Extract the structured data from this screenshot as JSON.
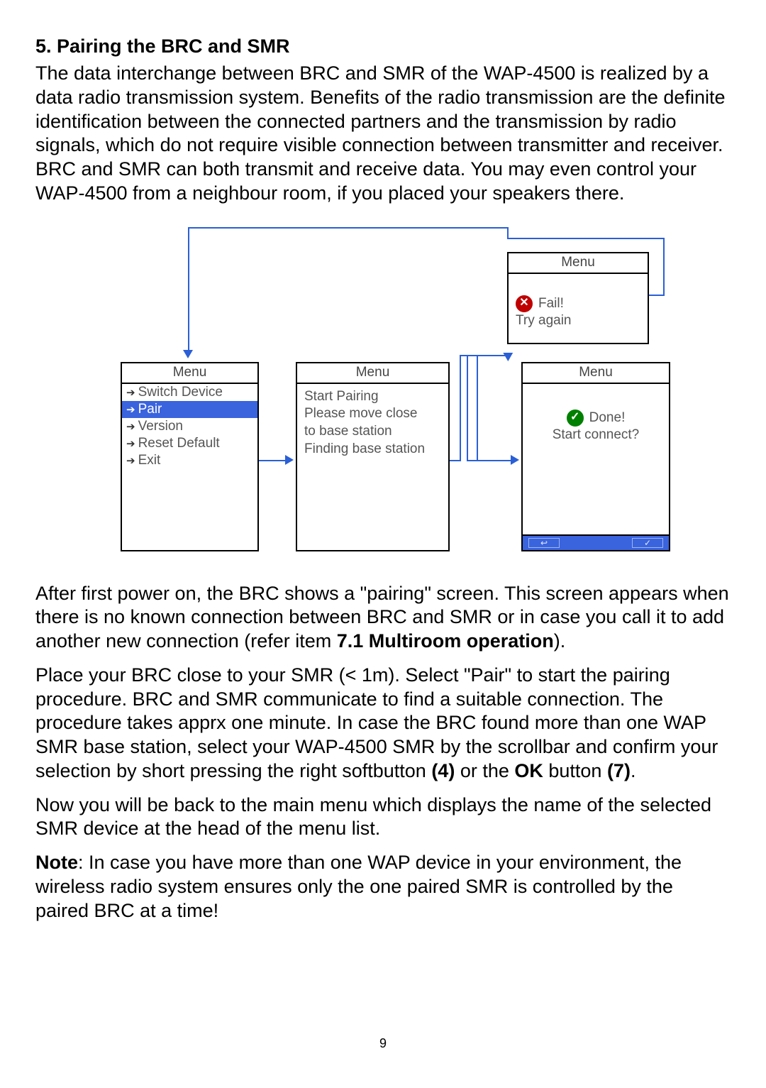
{
  "heading": "5. Pairing the BRC and SMR",
  "intro": "The data interchange between BRC and SMR of the WAP-4500 is realized by a data radio transmission system. Benefits of the radio transmission are the definite identification between the connected partners and the transmission by radio signals, which do not require visible connection between transmitter and receiver. BRC and SMR can both transmit and receive data. You may even control your WAP-4500 from a neighbour room, if you placed your speakers there.",
  "screens": {
    "menu_title": "Menu",
    "fail": {
      "label": "Fail!",
      "sub": "Try again"
    },
    "list": {
      "items": [
        "Switch Device",
        "Pair",
        "Version",
        "Reset Default",
        "Exit"
      ],
      "selected_index": 1
    },
    "pairing": {
      "l1": "Start Pairing",
      "l2": "Please move close",
      "l3": "to base station",
      "l4": "Finding base station"
    },
    "done": {
      "label": "Done!",
      "sub": "Start connect?"
    }
  },
  "after": {
    "p1a": "After first power on, the BRC shows a \"pairing\" screen. This screen appears when there is no known connection between BRC and SMR or in case you call it to add another new connection (refer item ",
    "p1b": "7.1 Multiroom operation",
    "p1c": ").",
    "p2a": "Place your BRC close to your SMR (< 1m). Select \"Pair\" to start the pairing procedure. BRC and SMR communicate to find a suitable connection. The procedure takes apprx one minute. In case the BRC found more than one WAP SMR base station, select your WAP-4500 SMR by the scrollbar and confirm your selection by short pressing the right softbutton ",
    "p2b": "(4)",
    "p2c": " or the ",
    "p2d": "OK",
    "p2e": " button ",
    "p2f": "(7)",
    "p2g": ".",
    "p3": "Now you will be back to the main menu which displays the name of the selected SMR device at the head of the menu list.",
    "p4a": "Note",
    "p4b": ": In case you have more than one WAP device in your environment, the wireless radio system ensures only the one paired SMR is controlled by the paired BRC at a time!"
  },
  "page_number": "9"
}
